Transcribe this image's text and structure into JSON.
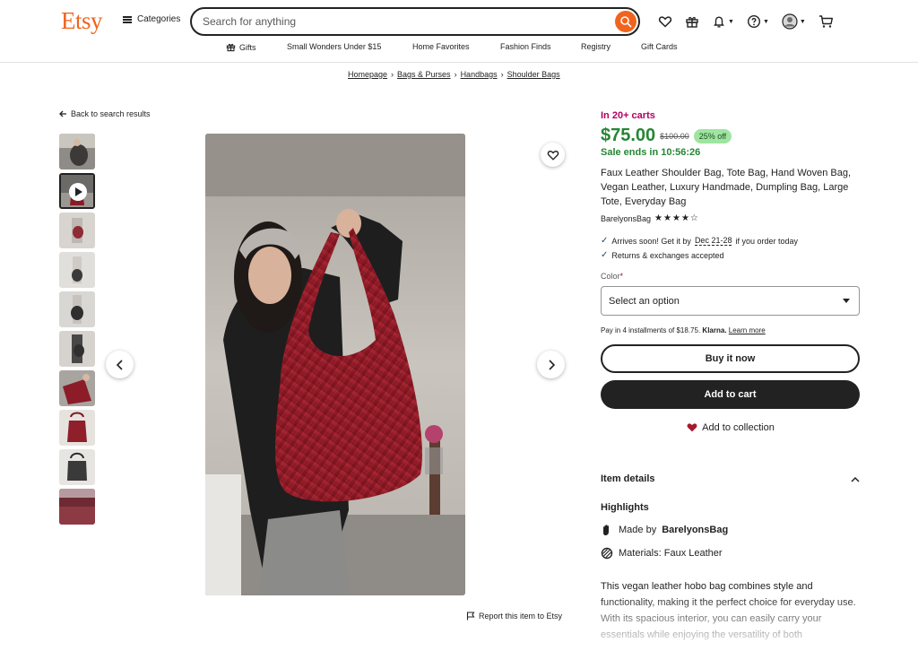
{
  "header": {
    "logo": "Etsy",
    "categories_label": "Categories",
    "search_placeholder": "Search for anything"
  },
  "subnav": [
    {
      "label": "Gifts",
      "icon": "gift-icon"
    },
    {
      "label": "Small Wonders Under $15"
    },
    {
      "label": "Home Favorites"
    },
    {
      "label": "Fashion Finds"
    },
    {
      "label": "Registry"
    },
    {
      "label": "Gift Cards"
    }
  ],
  "breadcrumb": [
    "Homepage",
    "Bags & Purses",
    "Handbags",
    "Shoulder Bags"
  ],
  "back_link": "Back to search results",
  "report_link": "Report this item to Etsy",
  "product": {
    "in_carts": "In 20+ carts",
    "price": "$75.00",
    "original_price": "$100.00",
    "discount": "25% off",
    "sale_ends": "Sale ends in 10:56:26",
    "title": "Faux Leather Shoulder Bag, Tote Bag, Hand Woven Bag, Vegan Leather, Luxury Handmade, Dumpling Bag, Large Tote, Everyday Bag",
    "shop_name": "BarelyonsBag",
    "rating": 4,
    "stars": "★★★★☆",
    "arrival_prefix": "Arrives soon! Get it by",
    "arrival_dates": "Dec 21-28",
    "arrival_suffix": "if you order today",
    "returns": "Returns & exchanges accepted",
    "color_label": "Color",
    "color_required": "*",
    "select_placeholder": "Select an option",
    "klarna_prefix": "Pay in 4 installments of $18.75.",
    "klarna_brand": "Klarna.",
    "klarna_learn": "Learn more",
    "buy_now": "Buy it now",
    "add_to_cart": "Add to cart",
    "add_to_collection": "Add to collection",
    "item_details": "Item details",
    "highlights": "Highlights",
    "made_by_prefix": "Made by",
    "made_by_shop": "BarelyonsBag",
    "materials": "Materials: Faux Leather",
    "description": "This vegan leather hobo bag combines style and functionality, making it the perfect choice for everyday use. With its spacious interior, you can easily carry your essentials while enjoying the versatility of both"
  },
  "colors": {
    "brand": "#f1641e",
    "price": "#258635",
    "in_carts": "#b3005f",
    "bag": "#8e1a26"
  }
}
